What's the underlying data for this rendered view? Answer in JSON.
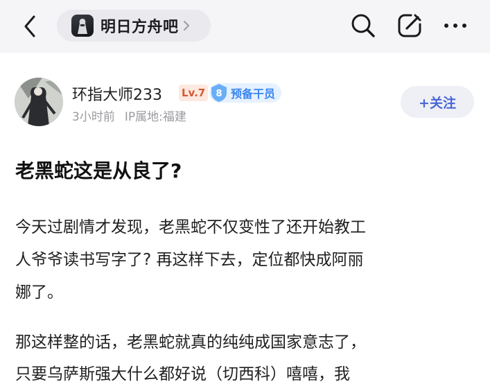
{
  "header": {
    "forum_name": "明日方舟吧",
    "icons": [
      "back-icon",
      "forum-logo-icon",
      "chevron-right-icon",
      "search-icon",
      "edit-icon",
      "more-icon"
    ]
  },
  "post": {
    "author": {
      "name": "环指大师233",
      "level": "Lv.7",
      "rank_number": "8",
      "rank_title": "预备干员",
      "time": "3小时前",
      "ip_location": "IP属地:福建"
    },
    "follow_label": "+关注",
    "title": "老黑蛇这是从良了?",
    "paragraphs": [
      {
        "lines": [
          "今天过剧情才发现，老黑蛇不仅变性了还开始教工",
          "人爷爷读书写字了? 再这样下去，定位都快成阿丽",
          "娜了。"
        ]
      },
      {
        "lines": [
          "那这样整的话，老黑蛇就真的纯纯成国家意志了，",
          "只要乌萨斯强大什么都好说（切西科）嘻嘻，我"
        ]
      }
    ]
  },
  "colors": {
    "topbar_bg": "#f5f5f7",
    "level_badge": "#d55a2f",
    "rank_blue": "#3a86f1",
    "follow_text": "#4a66d6"
  }
}
